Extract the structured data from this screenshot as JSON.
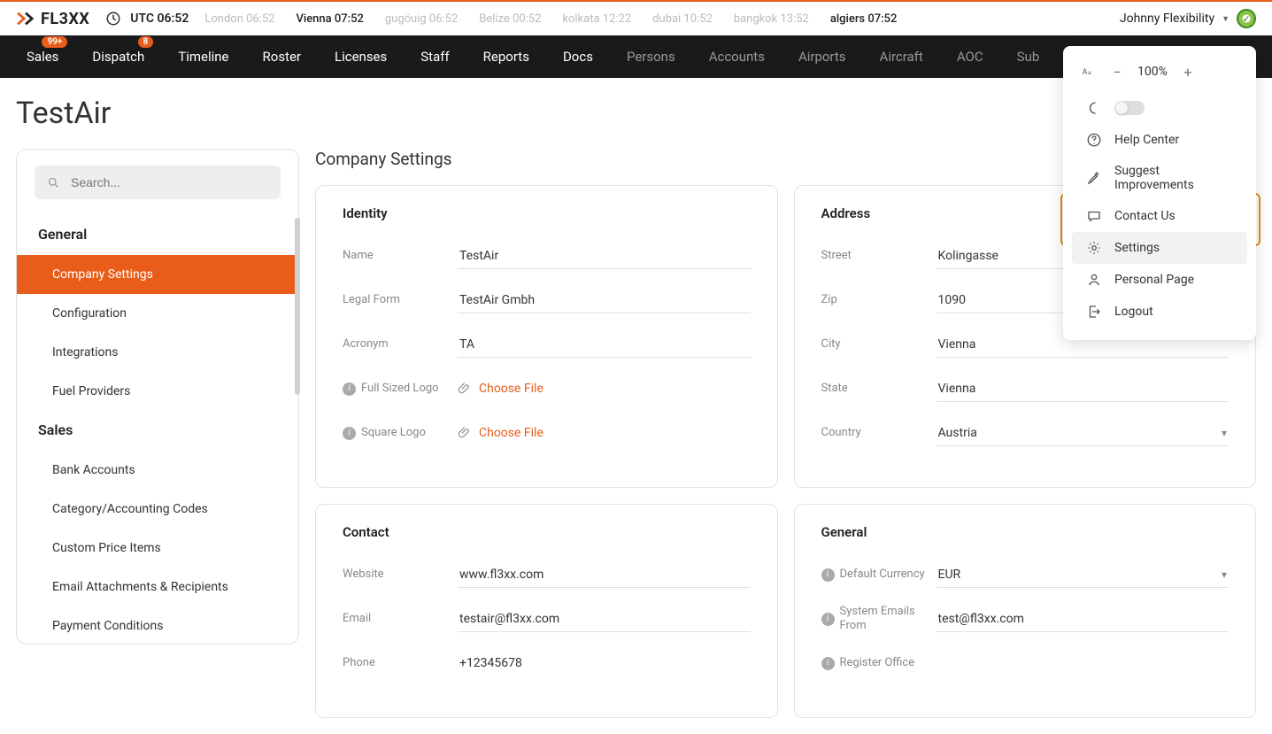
{
  "header": {
    "logo_text": "FL3XX",
    "utc_label": "UTC 06:52",
    "timezones": [
      {
        "label": "London 06:52",
        "active": false
      },
      {
        "label": "Vienna 07:52",
        "active": true
      },
      {
        "label": "gugöuig 06:52",
        "active": false
      },
      {
        "label": "Belize 00:52",
        "active": false
      },
      {
        "label": "kolkata 12:22",
        "active": false
      },
      {
        "label": "dubai 10:52",
        "active": false
      },
      {
        "label": "bangkok 13:52",
        "active": false
      },
      {
        "label": "algiers 07:52",
        "active": true
      }
    ],
    "user_name": "Johnny Flexibility"
  },
  "nav": [
    {
      "label": "Sales",
      "badge": "99+",
      "dim": false
    },
    {
      "label": "Dispatch",
      "badge": "8",
      "dim": false
    },
    {
      "label": "Timeline",
      "dim": false
    },
    {
      "label": "Roster",
      "dim": false
    },
    {
      "label": "Licenses",
      "dim": false
    },
    {
      "label": "Staff",
      "dim": false
    },
    {
      "label": "Reports",
      "dim": false
    },
    {
      "label": "Docs",
      "dim": false
    },
    {
      "label": "Persons",
      "dim": true
    },
    {
      "label": "Accounts",
      "dim": true
    },
    {
      "label": "Airports",
      "dim": true
    },
    {
      "label": "Aircraft",
      "dim": true
    },
    {
      "label": "AOC",
      "dim": true
    },
    {
      "label": "Sub",
      "dim": true
    }
  ],
  "page_title": "TestAir",
  "sidebar": {
    "search_placeholder": "Search...",
    "sections": [
      {
        "title": "General",
        "items": [
          {
            "label": "Company Settings",
            "active": true
          },
          {
            "label": "Configuration"
          },
          {
            "label": "Integrations"
          },
          {
            "label": "Fuel Providers"
          }
        ]
      },
      {
        "title": "Sales",
        "items": [
          {
            "label": "Bank Accounts"
          },
          {
            "label": "Category/Accounting Codes"
          },
          {
            "label": "Custom Price Items"
          },
          {
            "label": "Email Attachments & Recipients"
          },
          {
            "label": "Payment Conditions"
          }
        ]
      }
    ]
  },
  "main_title": "Company Settings",
  "cards": {
    "identity": {
      "title": "Identity",
      "name_label": "Name",
      "name_value": "TestAir",
      "legal_label": "Legal Form",
      "legal_value": "TestAir Gmbh",
      "acronym_label": "Acronym",
      "acronym_value": "TA",
      "full_logo_label": "Full Sized Logo",
      "choose_file": "Choose File",
      "square_logo_label": "Square Logo"
    },
    "address": {
      "title": "Address",
      "street_label": "Street",
      "street_value": "Kolingasse",
      "zip_label": "Zip",
      "zip_value": "1090",
      "city_label": "City",
      "city_value": "Vienna",
      "state_label": "State",
      "state_value": "Vienna",
      "country_label": "Country",
      "country_value": "Austria"
    },
    "contact": {
      "title": "Contact",
      "website_label": "Website",
      "website_value": "www.fl3xx.com",
      "email_label": "Email",
      "email_value": "testair@fl3xx.com",
      "phone_label": "Phone",
      "phone_value": "+12345678"
    },
    "general": {
      "title": "General",
      "currency_label": "Default Currency",
      "currency_value": "EUR",
      "sys_email_label": "System Emails From",
      "sys_email_value": "test@fl3xx.com",
      "reg_office_label": "Register Office"
    }
  },
  "user_menu": {
    "zoom": "100%",
    "items": [
      {
        "label": "Help Center",
        "icon": "help"
      },
      {
        "label": "Suggest Improvements",
        "icon": "suggest"
      },
      {
        "label": "Contact Us",
        "icon": "contact"
      },
      {
        "label": "Settings",
        "icon": "settings",
        "highlight": true
      },
      {
        "label": "Personal Page",
        "icon": "person"
      },
      {
        "label": "Logout",
        "icon": "logout"
      }
    ]
  }
}
